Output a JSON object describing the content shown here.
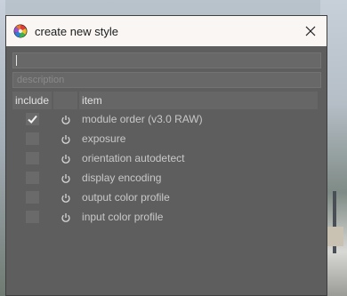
{
  "window": {
    "title": "create new style"
  },
  "fields": {
    "name_value": "",
    "description_placeholder": "description"
  },
  "table": {
    "columns": [
      "include",
      "",
      "item"
    ],
    "rows": [
      {
        "checked": true,
        "item": "module order (v3.0 RAW)"
      },
      {
        "checked": false,
        "item": "exposure"
      },
      {
        "checked": false,
        "item": "orientation autodetect"
      },
      {
        "checked": false,
        "item": "display encoding"
      },
      {
        "checked": false,
        "item": "output color profile"
      },
      {
        "checked": false,
        "item": "input color profile"
      }
    ]
  },
  "icons": {
    "app": "darktable-icon",
    "close": "close-icon",
    "row": "power-icon",
    "check": "checkmark-icon"
  }
}
